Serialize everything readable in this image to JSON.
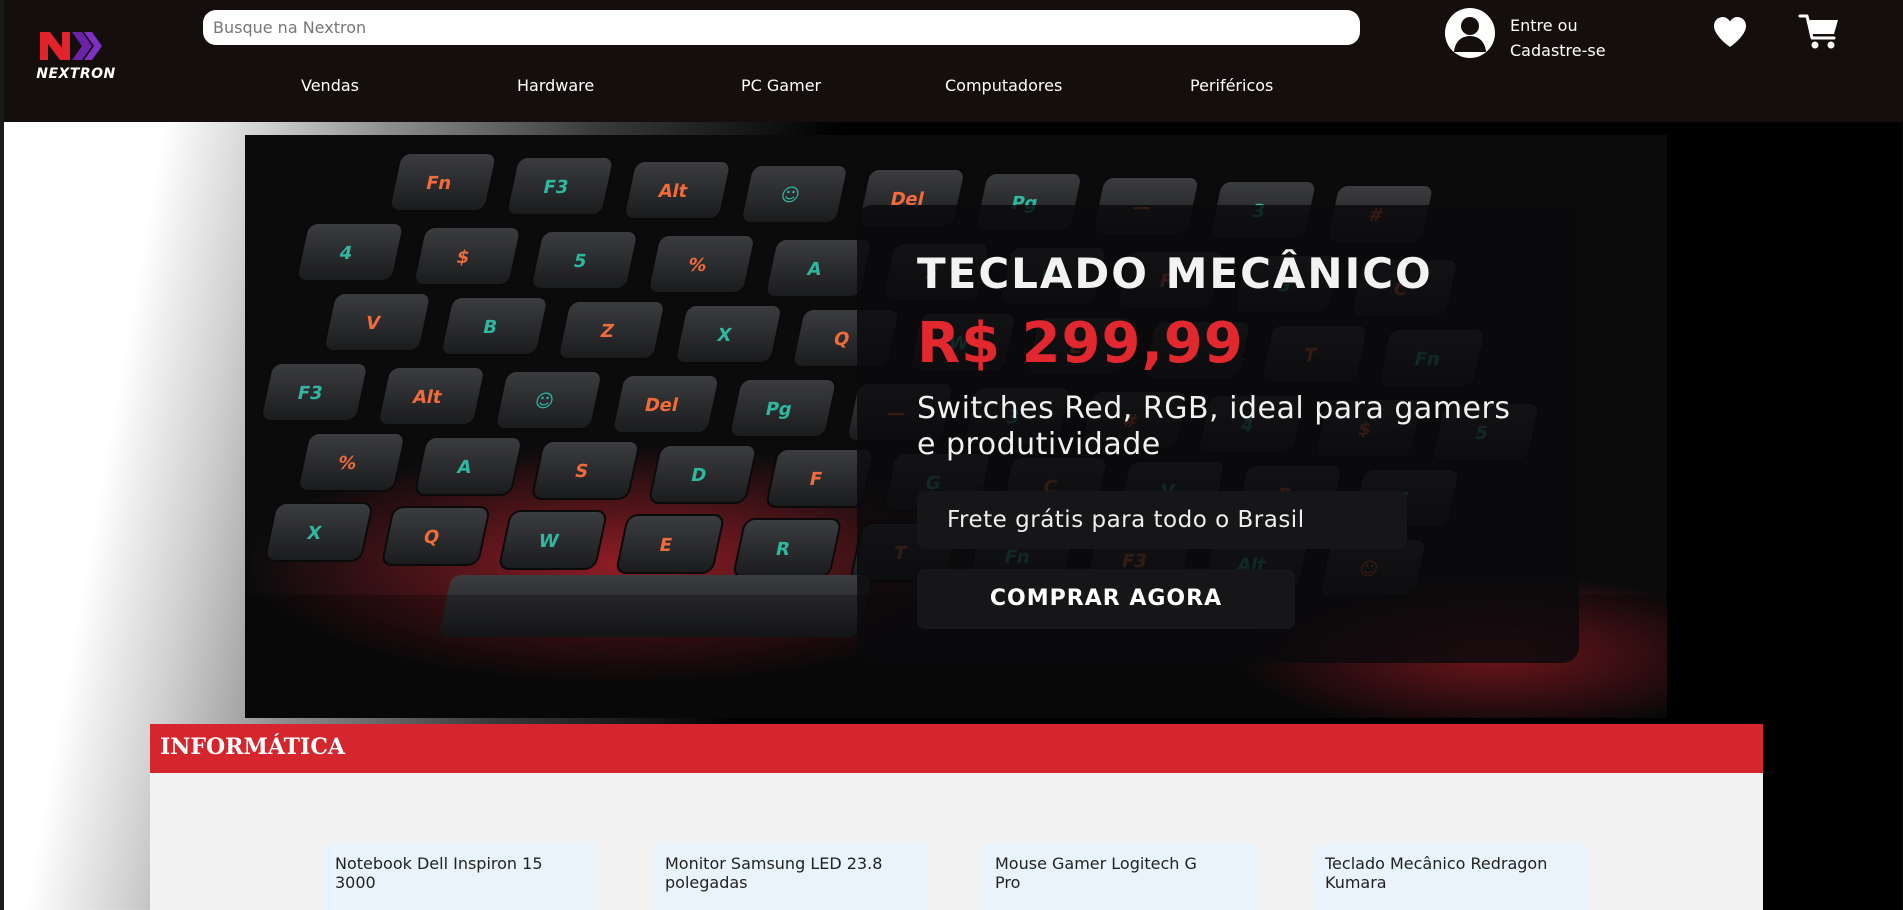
{
  "brand": {
    "name": "NEXTRON",
    "colors": {
      "primary": "#d4262c",
      "accent": "#6b21a8",
      "header_bg": "#140e0c"
    }
  },
  "search": {
    "placeholder": "Busque na Nextron",
    "value": ""
  },
  "nav": {
    "items": [
      "Vendas",
      "Hardware",
      "PC Gamer",
      "Computadores",
      "Periféricos"
    ]
  },
  "account": {
    "line1": "Entre ou",
    "line2": "Cadastre-se",
    "icon": "user-icon"
  },
  "icons": {
    "favorites": "heart-icon",
    "cart": "cart-icon"
  },
  "banner": {
    "title": "TECLADO MECÂNICO",
    "price": "R$ 299,99",
    "description": "Switches Red, RGB, ideal para gamers e produtividade",
    "shipping": "Frete grátis para todo o Brasil",
    "cta": "COMPRAR AGORA",
    "keycaps": [
      "Fn",
      "F3",
      "Alt",
      "☺",
      "Del",
      "Pg",
      "—",
      "3",
      "#",
      "4",
      "$",
      "5",
      "%",
      "A",
      "S",
      "D",
      "F",
      "G",
      "C",
      "V",
      "B",
      "Z",
      "X",
      "Q",
      "W",
      "E",
      "R",
      "T"
    ]
  },
  "section": {
    "title": "INFORMÁTICA",
    "products": [
      {
        "name": "Notebook Dell Inspiron 15 3000"
      },
      {
        "name": "Monitor Samsung LED 23.8 polegadas"
      },
      {
        "name": "Mouse Gamer Logitech G Pro"
      },
      {
        "name": "Teclado Mecânico Redragon Kumara"
      }
    ]
  }
}
